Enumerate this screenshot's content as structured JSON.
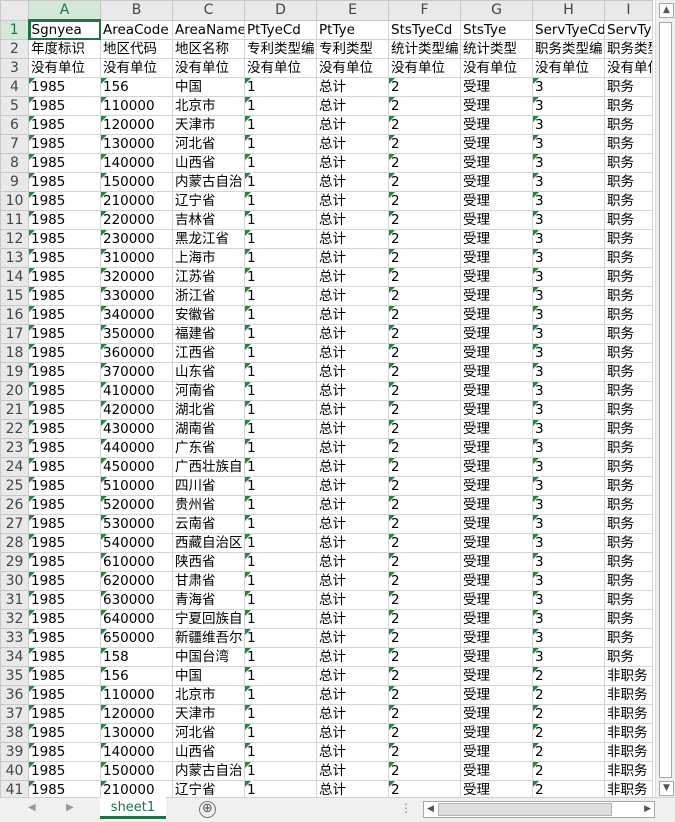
{
  "columns": [
    "A",
    "B",
    "C",
    "D",
    "E",
    "F",
    "G",
    "H",
    "I"
  ],
  "rows": [
    [
      "1",
      "Sgnyea",
      "AreaCode",
      "AreaName",
      "PtTyeCd",
      "PtTye",
      "StsTyeCd",
      "StsTye",
      "ServTyeCd",
      "ServTye"
    ],
    [
      "2",
      "年度标识",
      "地区代码",
      "地区名称",
      "专利类型编",
      "专利类型",
      "统计类型编",
      "统计类型",
      "职务类型编",
      "职务类型"
    ],
    [
      "3",
      "没有单位",
      "没有单位",
      "没有单位",
      "没有单位",
      "没有单位",
      "没有单位",
      "没有单位",
      "没有单位",
      "没有单位"
    ],
    [
      "4",
      "1985",
      "156",
      "中国",
      "1",
      "总计",
      "2",
      "受理",
      "3",
      "职务"
    ],
    [
      "5",
      "1985",
      "110000",
      "北京市",
      "1",
      "总计",
      "2",
      "受理",
      "3",
      "职务"
    ],
    [
      "6",
      "1985",
      "120000",
      "天津市",
      "1",
      "总计",
      "2",
      "受理",
      "3",
      "职务"
    ],
    [
      "7",
      "1985",
      "130000",
      "河北省",
      "1",
      "总计",
      "2",
      "受理",
      "3",
      "职务"
    ],
    [
      "8",
      "1985",
      "140000",
      "山西省",
      "1",
      "总计",
      "2",
      "受理",
      "3",
      "职务"
    ],
    [
      "9",
      "1985",
      "150000",
      "内蒙古自治",
      "1",
      "总计",
      "2",
      "受理",
      "3",
      "职务"
    ],
    [
      "10",
      "1985",
      "210000",
      "辽宁省",
      "1",
      "总计",
      "2",
      "受理",
      "3",
      "职务"
    ],
    [
      "11",
      "1985",
      "220000",
      "吉林省",
      "1",
      "总计",
      "2",
      "受理",
      "3",
      "职务"
    ],
    [
      "12",
      "1985",
      "230000",
      "黑龙江省",
      "1",
      "总计",
      "2",
      "受理",
      "3",
      "职务"
    ],
    [
      "13",
      "1985",
      "310000",
      "上海市",
      "1",
      "总计",
      "2",
      "受理",
      "3",
      "职务"
    ],
    [
      "14",
      "1985",
      "320000",
      "江苏省",
      "1",
      "总计",
      "2",
      "受理",
      "3",
      "职务"
    ],
    [
      "15",
      "1985",
      "330000",
      "浙江省",
      "1",
      "总计",
      "2",
      "受理",
      "3",
      "职务"
    ],
    [
      "16",
      "1985",
      "340000",
      "安徽省",
      "1",
      "总计",
      "2",
      "受理",
      "3",
      "职务"
    ],
    [
      "17",
      "1985",
      "350000",
      "福建省",
      "1",
      "总计",
      "2",
      "受理",
      "3",
      "职务"
    ],
    [
      "18",
      "1985",
      "360000",
      "江西省",
      "1",
      "总计",
      "2",
      "受理",
      "3",
      "职务"
    ],
    [
      "19",
      "1985",
      "370000",
      "山东省",
      "1",
      "总计",
      "2",
      "受理",
      "3",
      "职务"
    ],
    [
      "20",
      "1985",
      "410000",
      "河南省",
      "1",
      "总计",
      "2",
      "受理",
      "3",
      "职务"
    ],
    [
      "21",
      "1985",
      "420000",
      "湖北省",
      "1",
      "总计",
      "2",
      "受理",
      "3",
      "职务"
    ],
    [
      "22",
      "1985",
      "430000",
      "湖南省",
      "1",
      "总计",
      "2",
      "受理",
      "3",
      "职务"
    ],
    [
      "23",
      "1985",
      "440000",
      "广东省",
      "1",
      "总计",
      "2",
      "受理",
      "3",
      "职务"
    ],
    [
      "24",
      "1985",
      "450000",
      "广西壮族自",
      "1",
      "总计",
      "2",
      "受理",
      "3",
      "职务"
    ],
    [
      "25",
      "1985",
      "510000",
      "四川省",
      "1",
      "总计",
      "2",
      "受理",
      "3",
      "职务"
    ],
    [
      "26",
      "1985",
      "520000",
      "贵州省",
      "1",
      "总计",
      "2",
      "受理",
      "3",
      "职务"
    ],
    [
      "27",
      "1985",
      "530000",
      "云南省",
      "1",
      "总计",
      "2",
      "受理",
      "3",
      "职务"
    ],
    [
      "28",
      "1985",
      "540000",
      "西藏自治区",
      "1",
      "总计",
      "2",
      "受理",
      "3",
      "职务"
    ],
    [
      "29",
      "1985",
      "610000",
      "陕西省",
      "1",
      "总计",
      "2",
      "受理",
      "3",
      "职务"
    ],
    [
      "30",
      "1985",
      "620000",
      "甘肃省",
      "1",
      "总计",
      "2",
      "受理",
      "3",
      "职务"
    ],
    [
      "31",
      "1985",
      "630000",
      "青海省",
      "1",
      "总计",
      "2",
      "受理",
      "3",
      "职务"
    ],
    [
      "32",
      "1985",
      "640000",
      "宁夏回族自",
      "1",
      "总计",
      "2",
      "受理",
      "3",
      "职务"
    ],
    [
      "33",
      "1985",
      "650000",
      "新疆维吾尔",
      "1",
      "总计",
      "2",
      "受理",
      "3",
      "职务"
    ],
    [
      "34",
      "1985",
      "158",
      "中国台湾",
      "1",
      "总计",
      "2",
      "受理",
      "3",
      "职务"
    ],
    [
      "35",
      "1985",
      "156",
      "中国",
      "1",
      "总计",
      "2",
      "受理",
      "2",
      "非职务"
    ],
    [
      "36",
      "1985",
      "110000",
      "北京市",
      "1",
      "总计",
      "2",
      "受理",
      "2",
      "非职务"
    ],
    [
      "37",
      "1985",
      "120000",
      "天津市",
      "1",
      "总计",
      "2",
      "受理",
      "2",
      "非职务"
    ],
    [
      "38",
      "1985",
      "130000",
      "河北省",
      "1",
      "总计",
      "2",
      "受理",
      "2",
      "非职务"
    ],
    [
      "39",
      "1985",
      "140000",
      "山西省",
      "1",
      "总计",
      "2",
      "受理",
      "2",
      "非职务"
    ],
    [
      "40",
      "1985",
      "150000",
      "内蒙古自治",
      "1",
      "总计",
      "2",
      "受理",
      "2",
      "非职务"
    ],
    [
      "41",
      "1985",
      "210000",
      "辽宁省",
      "1",
      "总计",
      "2",
      "受理",
      "2",
      "非职务"
    ]
  ],
  "sheet_tab": "sheet1",
  "add_sheet": "⊕",
  "scroll": {
    "up": "▲",
    "down": "▼",
    "left": "◀",
    "right": "▶"
  },
  "bottom_nav": {
    "prev": "◀",
    "next": "▶",
    "dots": "⋮"
  },
  "colors": {
    "accent": "#217346",
    "header_bg": "#e9e9e9",
    "text_marker": "#1e8b3a"
  }
}
